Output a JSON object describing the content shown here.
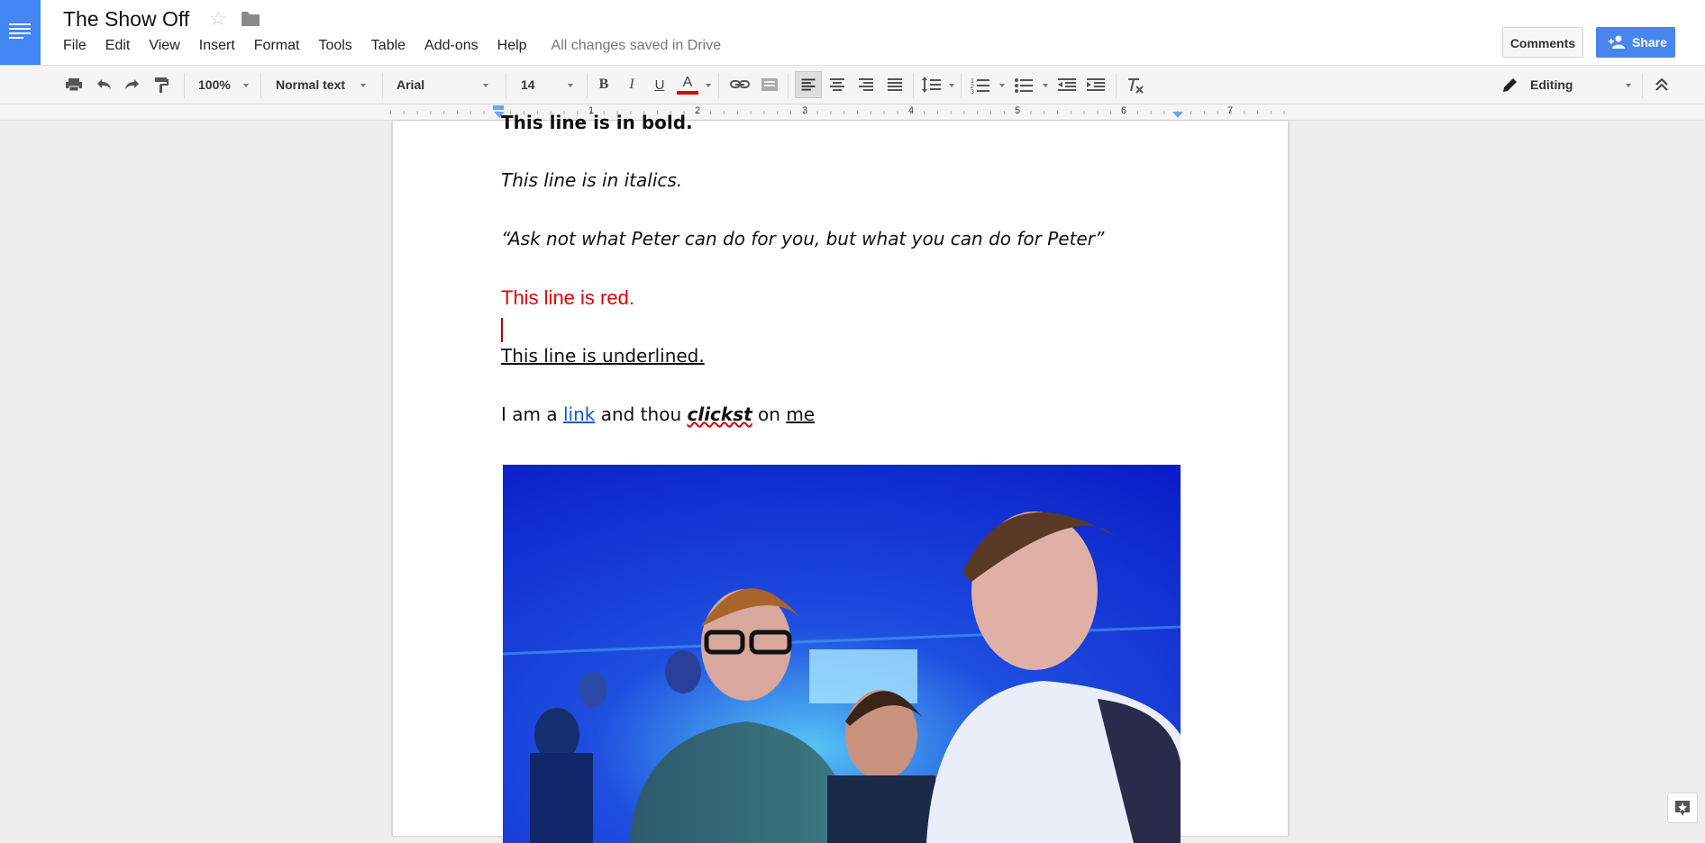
{
  "app": {
    "title": "The Show Off",
    "save_status": "All changes saved in Drive"
  },
  "menu": [
    "File",
    "Edit",
    "View",
    "Insert",
    "Format",
    "Tools",
    "Table",
    "Add-ons",
    "Help"
  ],
  "buttons": {
    "comments": "Comments",
    "share": "Share"
  },
  "toolbar": {
    "zoom": "100%",
    "style": "Normal text",
    "font": "Arial",
    "size": "14",
    "bold": "B",
    "italic": "I",
    "underline": "U",
    "text_color": "A",
    "text_color_value": "#e00000",
    "mode": "Editing"
  },
  "ruler": [
    "1",
    "2",
    "3",
    "4",
    "5",
    "6",
    "7"
  ],
  "document": {
    "line_bold": "This line is in bold.",
    "line_italic": "This line is in italics.",
    "line_quote": "“Ask not what Peter can do for you, but what you can do for Peter”",
    "line_red": "This line is red.",
    "line_underlined": "This line is underlined.",
    "link_line": {
      "pre": "I am a ",
      "link": "link",
      "mid": " and thou ",
      "bold_italic": "clickst",
      "mid2": " on ",
      "underlined": "me"
    },
    "image_description": "photo"
  },
  "colors": {
    "accent": "#4285f4",
    "share_button": "#4787ed",
    "link": "#1155cc",
    "red_text": "#e00000"
  }
}
